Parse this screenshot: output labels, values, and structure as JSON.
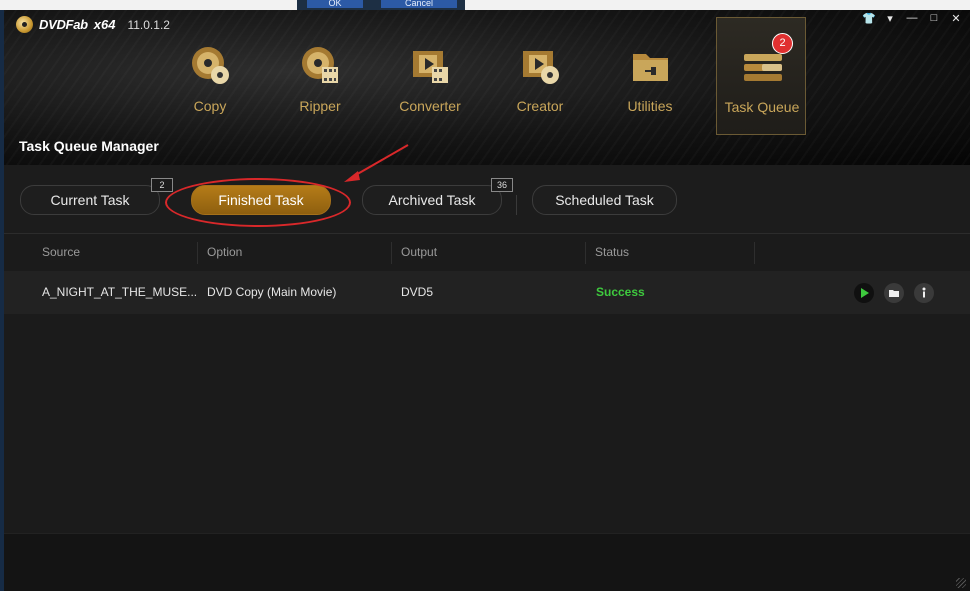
{
  "background_dialog": {
    "ok_label": "OK",
    "cancel_label": "Cancel"
  },
  "app": {
    "brand": "DVDFab",
    "arch": "x64",
    "version": "11.0.1.2"
  },
  "window_controls": [
    {
      "name": "skin-icon",
      "glyph": "▼"
    },
    {
      "name": "menu-icon",
      "glyph": "▾"
    },
    {
      "name": "minimize-icon",
      "glyph": "—"
    },
    {
      "name": "maximize-icon",
      "glyph": "□"
    },
    {
      "name": "close-icon",
      "glyph": "✕"
    }
  ],
  "nav": [
    {
      "label": "Copy",
      "icon": "disc-copy-icon"
    },
    {
      "label": "Ripper",
      "icon": "disc-ripper-icon"
    },
    {
      "label": "Converter",
      "icon": "film-converter-icon"
    },
    {
      "label": "Creator",
      "icon": "film-creator-icon"
    },
    {
      "label": "Utilities",
      "icon": "folder-utilities-icon"
    },
    {
      "label": "Task Queue",
      "icon": "task-queue-icon",
      "badge": "2",
      "active": true
    }
  ],
  "section_title": "Task Queue Manager",
  "tabs": [
    {
      "label": "Current Task",
      "count": "2"
    },
    {
      "label": "Finished Task",
      "active": true
    },
    {
      "label": "Archived Task",
      "count": "36"
    },
    {
      "label": "Scheduled Task"
    }
  ],
  "table": {
    "columns": [
      "Source",
      "Option",
      "Output",
      "Status"
    ],
    "rows": [
      {
        "source": "A_NIGHT_AT_THE_MUSE...",
        "option": "DVD Copy (Main Movie)",
        "output": "DVD5",
        "status": "Success"
      }
    ]
  },
  "colors": {
    "accent_gold": "#c9a65a",
    "active_tab": "#b57c18",
    "success": "#3ec93e",
    "badge": "#e03030",
    "annotation": "#d9282a"
  }
}
